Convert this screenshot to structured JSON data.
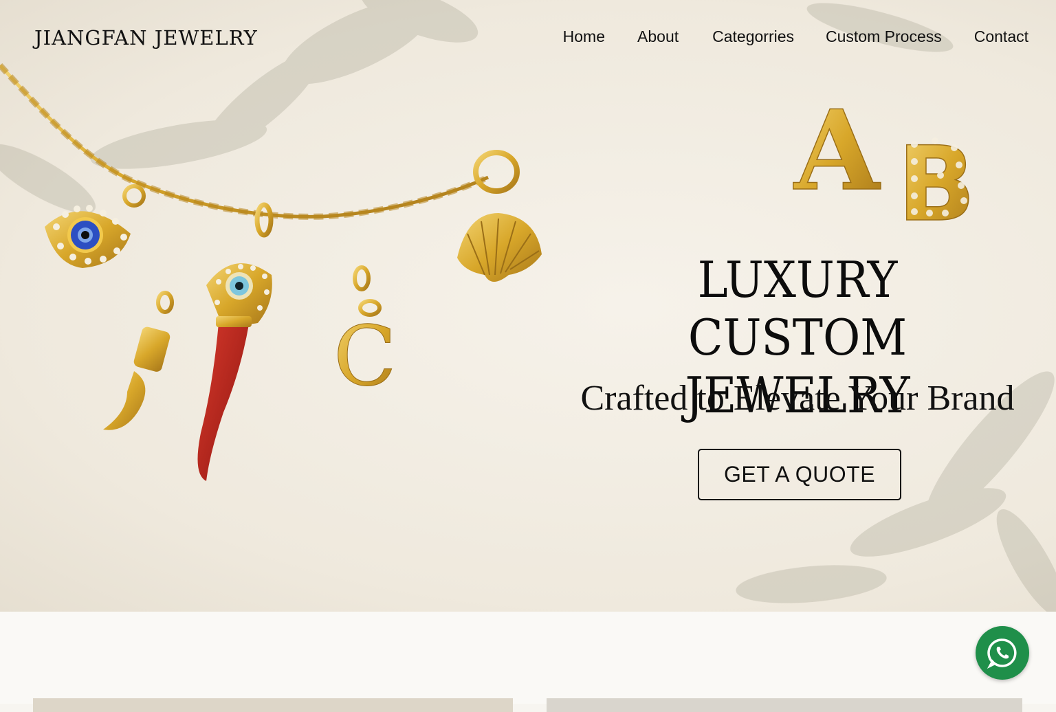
{
  "header": {
    "brand": "JIANGFAN JEWELRY",
    "nav": [
      "Home",
      "About",
      "Categorries",
      "Custom Process",
      "Contact"
    ]
  },
  "hero": {
    "headline_line1": "LUXURY CUSTOM",
    "headline_line2": "JEWELRY",
    "subheadline": "Crafted to Elevate Your Brand",
    "cta_label": "GET A QUOTE",
    "pendant_letters": [
      "A",
      "B",
      "C"
    ]
  },
  "floating": {
    "icon": "whatsapp-icon"
  },
  "colors": {
    "gold": "#d8a72a",
    "coral": "#b6231c",
    "whatsapp": "#1f8f4a"
  }
}
